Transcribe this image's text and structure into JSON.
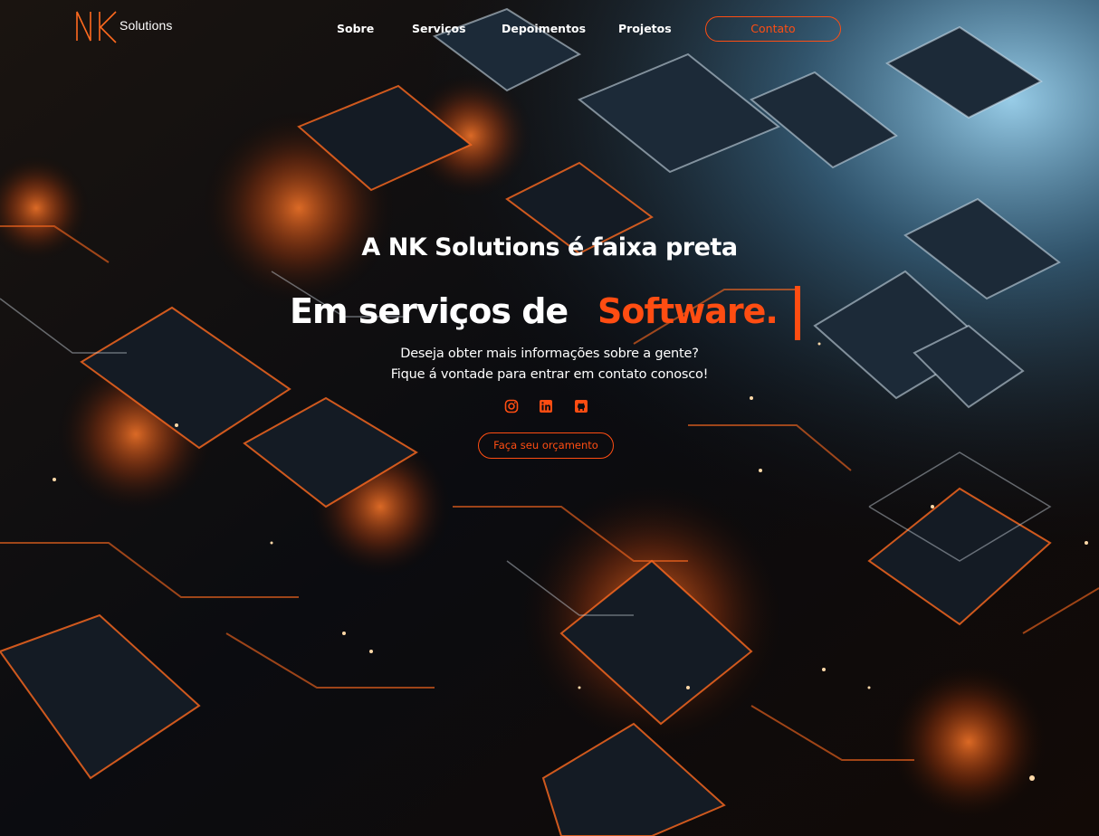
{
  "brand": {
    "logo_text": "Solutions",
    "logo_mark_icon": "nk-monogram-icon",
    "accent_color": "#ff4d12"
  },
  "nav": {
    "items": [
      {
        "label": "Sobre"
      },
      {
        "label": "Serviços"
      },
      {
        "label": "Depoimentos"
      },
      {
        "label": "Projetos"
      }
    ],
    "contact_label": "Contato"
  },
  "hero": {
    "title": "A NK Solutions é faixa preta",
    "line_prefix": "Em serviços de",
    "line_typed": "Software.",
    "subtitle_1": "Deseja obter mais informações sobre a gente?",
    "subtitle_2": "Fique á vontade para entrar em contato conosco!",
    "socials": [
      {
        "icon": "instagram-icon"
      },
      {
        "icon": "linkedin-icon"
      },
      {
        "icon": "github-icon"
      }
    ],
    "cta_label": "Faça seu orçamento"
  }
}
